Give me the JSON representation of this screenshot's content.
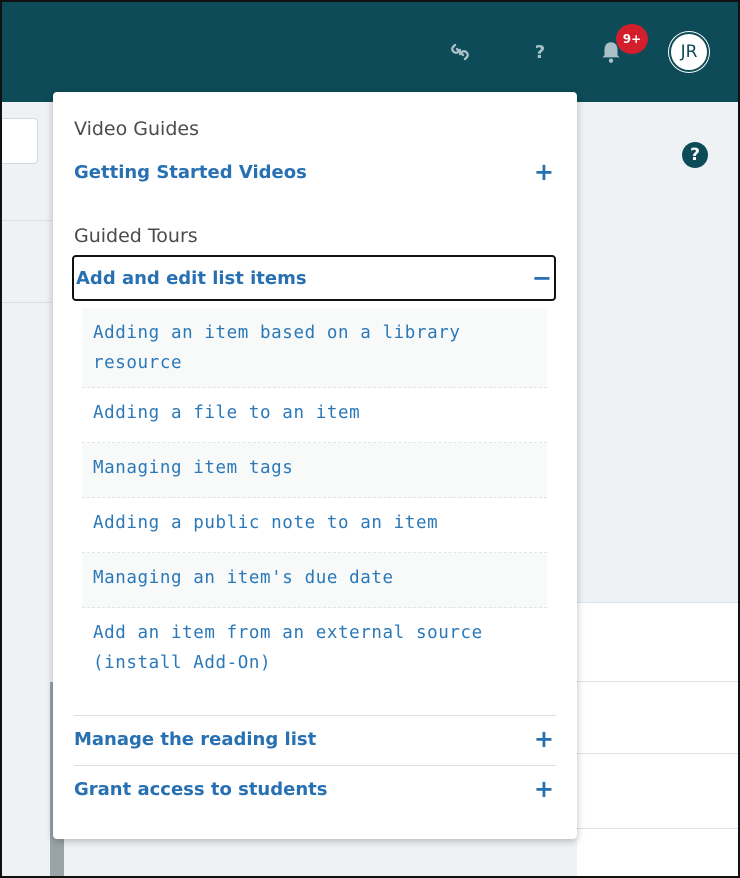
{
  "topbar": {
    "link_icon": "link-icon",
    "help_icon": "question-icon",
    "help_glyph": "?",
    "bell_icon": "bell-icon",
    "notification_count": "9+",
    "avatar_initials": "JR",
    "colors": {
      "background": "#0c4b57",
      "badge": "#d21f2b"
    }
  },
  "page": {
    "help_glyph": "?"
  },
  "panel": {
    "video_guides": {
      "heading": "Video Guides",
      "items": [
        {
          "label": "Getting Started Videos",
          "toggle": "+"
        }
      ]
    },
    "guided_tours": {
      "heading": "Guided Tours",
      "items": [
        {
          "label": "Add and edit list items",
          "toggle": "−",
          "expanded": true,
          "subitems": [
            "Adding an item based on a library resource",
            "Adding a file to an item",
            "Managing item tags",
            "Adding a public note to an item",
            "Managing an item's due date",
            "Add an item from an external source (install Add-On)"
          ]
        },
        {
          "label": "Manage the reading list",
          "toggle": "+"
        },
        {
          "label": "Grant access to students",
          "toggle": "+"
        }
      ]
    },
    "colors": {
      "link": "#2770b2",
      "heading": "#4b4b4b"
    }
  }
}
